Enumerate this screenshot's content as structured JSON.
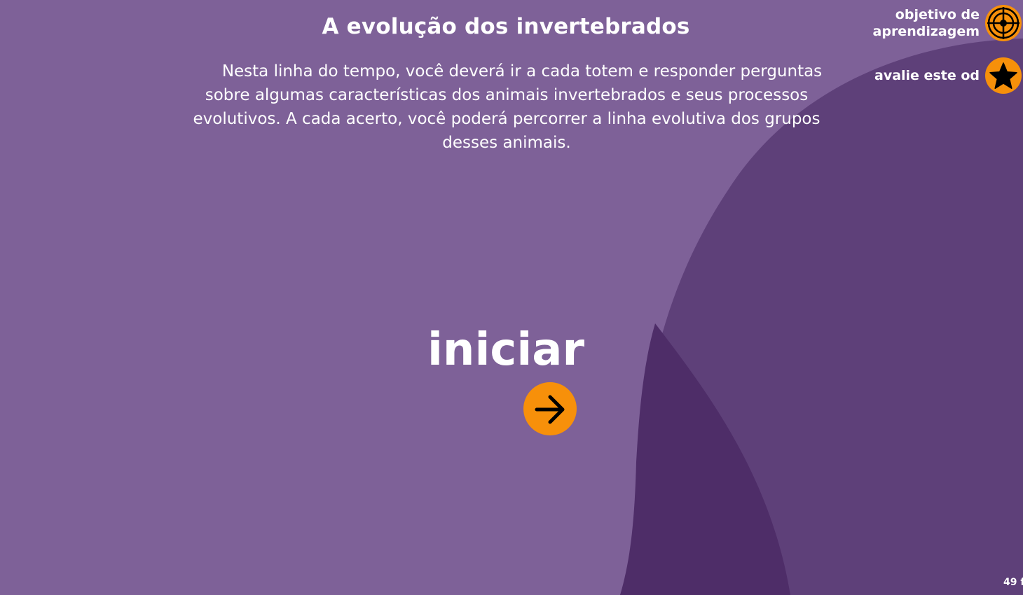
{
  "page": {
    "title": "A evolução dos invertebrados",
    "intro": "Nesta linha do tempo, você deverá ir a cada totem e responder perguntas sobre algumas características dos animais invertebrados e seus processos evolutivos. A cada acerto, você poderá percorrer a linha evolutiva dos grupos desses animais.",
    "start_label": "iniciar",
    "corner_counter": "49 f"
  },
  "side_menu": {
    "objective": {
      "label": "objetivo de aprendizagem",
      "icon": "target-icon"
    },
    "rate": {
      "label": "avalie este od",
      "icon": "star-icon"
    }
  },
  "icons": {
    "start": "arrow-right-icon"
  },
  "colors": {
    "background": "#7e6198",
    "shape_mid": "#5e4079",
    "shape_dark": "#4e2d68",
    "accent": "#f7900a",
    "text": "#ffffff"
  }
}
